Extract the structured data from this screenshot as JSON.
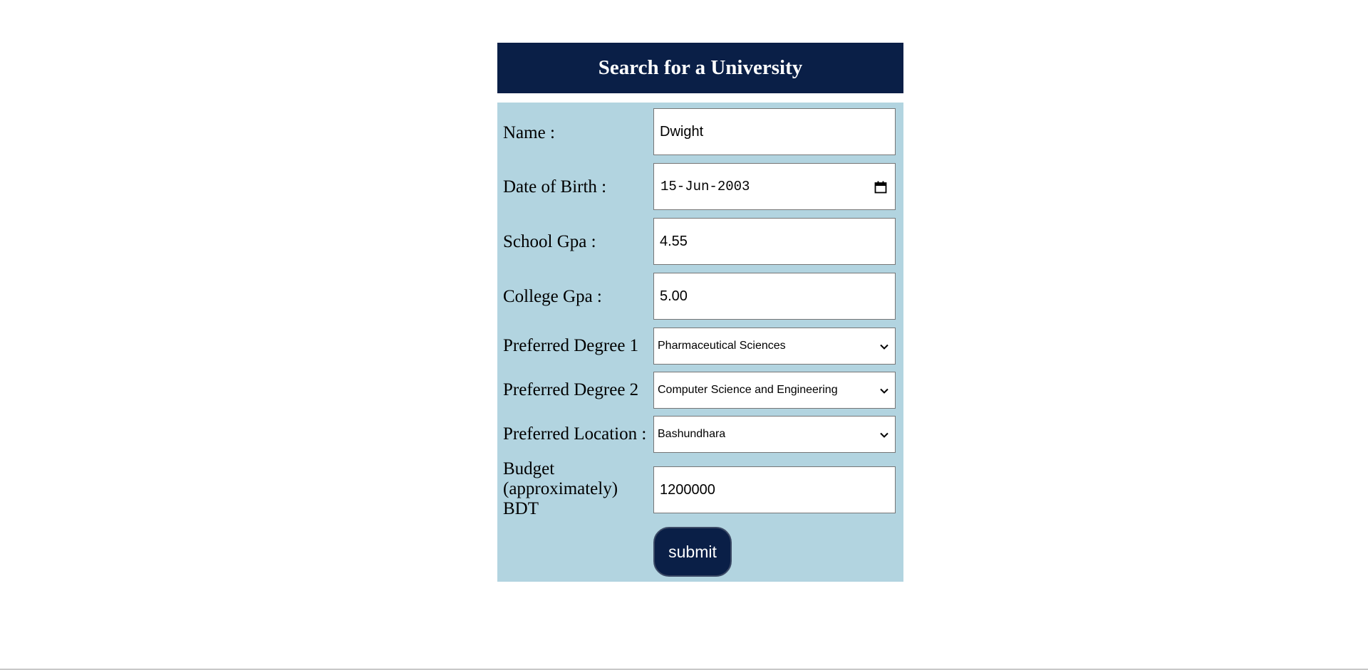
{
  "header": {
    "title": "Search for a University"
  },
  "form": {
    "name": {
      "label": "Name :",
      "value": "Dwight"
    },
    "dob": {
      "label": "Date of Birth :",
      "value": "15-Jun-2003"
    },
    "school_gpa": {
      "label": "School Gpa :",
      "value": "4.55"
    },
    "college_gpa": {
      "label": "College Gpa :",
      "value": "5.00"
    },
    "degree1": {
      "label": "Preferred Degree 1",
      "selected": "Pharmaceutical Sciences"
    },
    "degree2": {
      "label": "Preferred Degree 2",
      "selected": "Computer Science and Engineering"
    },
    "location": {
      "label": "Preferred Location :",
      "selected": "Bashundhara"
    },
    "budget": {
      "label": "Budget (approximately) BDT",
      "value": "1200000"
    },
    "submit_label": "submit"
  },
  "icons": {
    "calendar": "calendar-icon",
    "chevron": "chevron-down-icon"
  },
  "colors": {
    "header_bg": "#0a1f47",
    "panel_bg": "#b2d4e0",
    "button_bg": "#0a1f47"
  }
}
